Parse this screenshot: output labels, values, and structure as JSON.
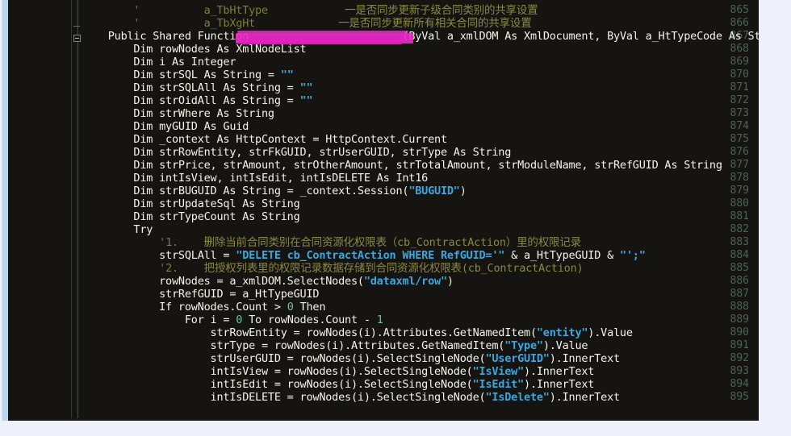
{
  "editor": {
    "theme_background": "#151410",
    "gutter_background": "#151410",
    "line_number_color": "#4e6354",
    "page_background": "#eef1fa",
    "redaction_color": "#ee27c9",
    "first_line_number": 865,
    "last_line_number": 895,
    "language": "VB.NET"
  },
  "line_numbers": [
    "865",
    "866",
    "867",
    "868",
    "869",
    "870",
    "871",
    "872",
    "873",
    "874",
    "875",
    "876",
    "877",
    "878",
    "879",
    "880",
    "881",
    "882",
    "883",
    "884",
    "885",
    "886",
    "887",
    "888",
    "889",
    "890",
    "891",
    "892",
    "893",
    "894",
    "895"
  ],
  "lines": [
    {
      "number": "865",
      "indent": 0,
      "segments": [
        {
          "t": "        ",
          "c": "op"
        },
        {
          "t": "'",
          "c": "cmt"
        },
        {
          "t": "          a_TbHtType            ",
          "c": "cmt"
        },
        {
          "t": "一是否同步更新子级合同类别的共享设置",
          "c": "cmtcn"
        }
      ]
    },
    {
      "number": "866",
      "indent": 0,
      "segments": [
        {
          "t": "        ",
          "c": "op"
        },
        {
          "t": "'",
          "c": "cmt"
        },
        {
          "t": "          a_TbXgHt             ",
          "c": "cmt"
        },
        {
          "t": "一是否同步更新所有相关合同的共享设置",
          "c": "cmtcn"
        }
      ]
    },
    {
      "number": "867",
      "indent": 0,
      "segments": [
        {
          "t": "    Public Shared Function ",
          "c": "kw"
        },
        {
          "t": "                       ",
          "c": "id"
        },
        {
          "t": "(ByVal a_xmlDOM As XmlDocument, ByVal a_HtTypeCode As St",
          "c": "id"
        }
      ]
    },
    {
      "number": "868",
      "indent": 0,
      "segments": [
        {
          "t": "        Dim rowNodes As XmlNodeList",
          "c": "kw"
        }
      ]
    },
    {
      "number": "869",
      "indent": 0,
      "segments": [
        {
          "t": "        Dim i As Integer",
          "c": "kw"
        }
      ]
    },
    {
      "number": "870",
      "indent": 0,
      "segments": [
        {
          "t": "        Dim strSQL As String = ",
          "c": "kw"
        },
        {
          "t": "\"\"",
          "c": "str"
        }
      ]
    },
    {
      "number": "871",
      "indent": 0,
      "segments": [
        {
          "t": "        Dim strSQLAll As String = ",
          "c": "kw"
        },
        {
          "t": "\"\"",
          "c": "str"
        }
      ]
    },
    {
      "number": "872",
      "indent": 0,
      "segments": [
        {
          "t": "        Dim strOidAll As String = ",
          "c": "kw"
        },
        {
          "t": "\"\"",
          "c": "str"
        }
      ]
    },
    {
      "number": "873",
      "indent": 0,
      "segments": [
        {
          "t": "        Dim strWhere As String",
          "c": "kw"
        }
      ]
    },
    {
      "number": "874",
      "indent": 0,
      "segments": [
        {
          "t": "        Dim myGUID As Guid",
          "c": "kw"
        }
      ]
    },
    {
      "number": "875",
      "indent": 0,
      "segments": [
        {
          "t": "        Dim _context As HttpContext = HttpContext.Current",
          "c": "kw"
        }
      ]
    },
    {
      "number": "876",
      "indent": 0,
      "segments": [
        {
          "t": "        Dim strRowEntity, strFkGUID, strUserGUID, strType As String",
          "c": "kw"
        }
      ]
    },
    {
      "number": "877",
      "indent": 0,
      "segments": [
        {
          "t": "        Dim strPrice, strAmount, strOtherAmount, strTotalAmount, strModuleName, strRefGUID As String",
          "c": "kw"
        }
      ]
    },
    {
      "number": "878",
      "indent": 0,
      "segments": [
        {
          "t": "        Dim intIsView, intIsEdit, intIsDELETE As Int16",
          "c": "kw"
        }
      ]
    },
    {
      "number": "879",
      "indent": 0,
      "segments": [
        {
          "t": "        Dim strBUGUID As String = _context.Session(",
          "c": "kw"
        },
        {
          "t": "\"BUGUID\"",
          "c": "str"
        },
        {
          "t": ")",
          "c": "op"
        }
      ]
    },
    {
      "number": "880",
      "indent": 0,
      "segments": [
        {
          "t": "        Dim strUpdateSql As String",
          "c": "kw"
        }
      ]
    },
    {
      "number": "881",
      "indent": 0,
      "segments": [
        {
          "t": "        Dim strTypeCount As String",
          "c": "kw"
        }
      ]
    },
    {
      "number": "882",
      "indent": 0,
      "segments": [
        {
          "t": "        Try",
          "c": "kw"
        }
      ]
    },
    {
      "number": "883",
      "indent": 0,
      "segments": [
        {
          "t": "            ",
          "c": "op"
        },
        {
          "t": "'1.    ",
          "c": "cmt"
        },
        {
          "t": "删除当前合同类别在合同资源化权限表（cb_ContractAction）里的权限记录",
          "c": "cmtcn"
        }
      ]
    },
    {
      "number": "884",
      "indent": 0,
      "segments": [
        {
          "t": "            strSQLAll = ",
          "c": "kw"
        },
        {
          "t": "\"DELETE cb_ContractAction WHERE RefGUID='\"",
          "c": "str"
        },
        {
          "t": " & a_HtTypeGUID & ",
          "c": "kw"
        },
        {
          "t": "\"';\"",
          "c": "str"
        }
      ]
    },
    {
      "number": "885",
      "indent": 0,
      "segments": [
        {
          "t": "            ",
          "c": "op"
        },
        {
          "t": "'2.    ",
          "c": "cmt"
        },
        {
          "t": "把授权列表里的权限记录数据存储到合同资源化权限表(cb_ContractAction)",
          "c": "cmtcn"
        }
      ]
    },
    {
      "number": "886",
      "indent": 0,
      "segments": [
        {
          "t": "            rowNodes = a_xmlDOM.SelectNodes(",
          "c": "kw"
        },
        {
          "t": "\"dataxml/row\"",
          "c": "str"
        },
        {
          "t": ")",
          "c": "op"
        }
      ]
    },
    {
      "number": "887",
      "indent": 0,
      "segments": [
        {
          "t": "            strRefGUID = a_HtTypeGUID",
          "c": "kw"
        }
      ]
    },
    {
      "number": "888",
      "indent": 0,
      "segments": [
        {
          "t": "            If rowNodes.Count > ",
          "c": "kw"
        },
        {
          "t": "0",
          "c": "num"
        },
        {
          "t": " Then",
          "c": "kw"
        }
      ]
    },
    {
      "number": "889",
      "indent": 0,
      "segments": [
        {
          "t": "                For i = ",
          "c": "kw"
        },
        {
          "t": "0",
          "c": "num"
        },
        {
          "t": " To rowNodes.Count - ",
          "c": "kw"
        },
        {
          "t": "1",
          "c": "num"
        }
      ]
    },
    {
      "number": "890",
      "indent": 0,
      "segments": [
        {
          "t": "                    strRowEntity = rowNodes(i).Attributes.GetNamedItem(",
          "c": "kw"
        },
        {
          "t": "\"entity\"",
          "c": "str"
        },
        {
          "t": ").Value",
          "c": "kw"
        }
      ]
    },
    {
      "number": "891",
      "indent": 0,
      "segments": [
        {
          "t": "                    strType = rowNodes(i).Attributes.GetNamedItem(",
          "c": "kw"
        },
        {
          "t": "\"Type\"",
          "c": "str"
        },
        {
          "t": ").Value",
          "c": "kw"
        }
      ]
    },
    {
      "number": "892",
      "indent": 0,
      "segments": [
        {
          "t": "                    strUserGUID = rowNodes(i).SelectSingleNode(",
          "c": "kw"
        },
        {
          "t": "\"UserGUID\"",
          "c": "str"
        },
        {
          "t": ").InnerText",
          "c": "kw"
        }
      ]
    },
    {
      "number": "893",
      "indent": 0,
      "segments": [
        {
          "t": "                    intIsView = rowNodes(i).SelectSingleNode(",
          "c": "kw"
        },
        {
          "t": "\"IsView\"",
          "c": "str"
        },
        {
          "t": ").InnerText",
          "c": "kw"
        }
      ]
    },
    {
      "number": "894",
      "indent": 0,
      "segments": [
        {
          "t": "                    intIsEdit = rowNodes(i).SelectSingleNode(",
          "c": "kw"
        },
        {
          "t": "\"IsEdit\"",
          "c": "str"
        },
        {
          "t": ").InnerText",
          "c": "kw"
        }
      ]
    },
    {
      "number": "895",
      "indent": 0,
      "segments": [
        {
          "t": "                    intIsDELETE = rowNodes(i).SelectSingleNode(",
          "c": "kw"
        },
        {
          "t": "\"IsDelete\"",
          "c": "str"
        },
        {
          "t": ").InnerText",
          "c": "kw"
        }
      ]
    }
  ],
  "outlining": {
    "collapse_marker_line": "867",
    "collapse_glyph": "minus",
    "region_tick_line": "866"
  },
  "redaction": {
    "covers_line": "867",
    "description": "function-name-redacted",
    "color": "#ee27c9"
  }
}
